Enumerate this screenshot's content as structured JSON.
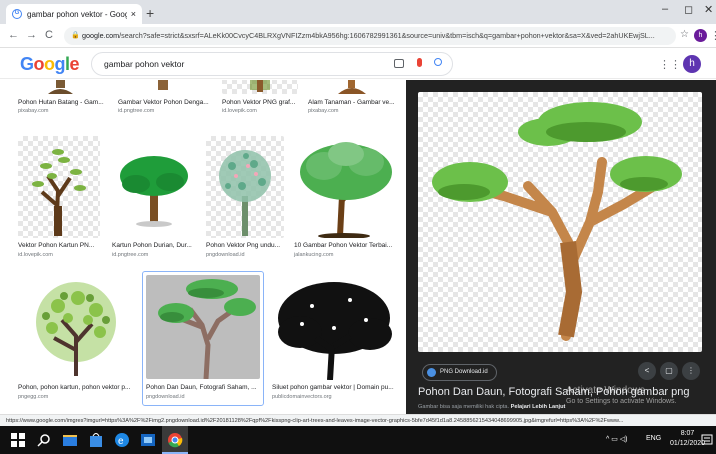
{
  "browser": {
    "tab_title": "gambar pohon vektor - Google I",
    "tab_favicon": "G",
    "tab_close": "×",
    "new_tab": "+",
    "win_min": "–",
    "win_max": "◻",
    "win_close": "✕",
    "back": "←",
    "forward": "→",
    "reload": "C",
    "url_host": "google.com",
    "url_rest": "/search?safe=strict&sxsrf=ALeKk00CvcyC4BLRXgVNFIZzm4bkA956hg:1606782991361&source=univ&tbm=isch&q=gambar+pohon+vektor&sa=X&ved=2ahUKEwjSL...",
    "star": "☆",
    "profile_letter": "h",
    "menu": "⋮"
  },
  "google": {
    "logo": [
      "G",
      "o",
      "o",
      "g",
      "l",
      "e"
    ],
    "query": "gambar pohon vektor",
    "apps_icon": "⋮⋮⋮",
    "avatar_letter": "h"
  },
  "results_row0": [
    {
      "title": "Pohon Hutan Batang - Gam...",
      "source": "pixabay.com"
    },
    {
      "title": "Gambar Vektor Pohon Denga...",
      "source": "id.pngtree.com"
    },
    {
      "title": "Pohon Vektor PNG graf...",
      "source": "id.lovepik.com"
    },
    {
      "title": "Alam Tanaman - Gambar ve...",
      "source": "pixabay.com"
    }
  ],
  "results_row1": [
    {
      "title": "Vektor Pohon Kartun PN...",
      "source": "id.lovepik.com"
    },
    {
      "title": "Kartun Pohon Durian, Dur...",
      "source": "id.pngtree.com"
    },
    {
      "title": "Pohon Vektor Png undu...",
      "source": "pngdownload.id"
    },
    {
      "title": "10 Gambar Pohon Vektor Terbai...",
      "source": "jalankucing.com"
    }
  ],
  "results_row2": [
    {
      "title": "Pohon, pohon kartun, pohon vektor p...",
      "source": "pngegg.com"
    },
    {
      "title": "Pohon Dan Daun, Fotografi Saham, ...",
      "source": "pngdownload.id"
    },
    {
      "title": "Siluet pohon gambar vektor | Domain pu...",
      "source": "publicdomainvectors.org"
    }
  ],
  "panel": {
    "close": "✕",
    "prev": "‹",
    "next": "›",
    "site_chip": "PNG Download.id",
    "share": "<",
    "save": "▢",
    "more": "⋮",
    "title": "Pohon Dan Daun, Fotografi Saham, Pohon gambar png",
    "subtitle": "Gambar bisa saja memiliki hak cipta.",
    "learn_more": "Pelajari Lebih Lanjut"
  },
  "watermark": {
    "line1": "Activate Windows",
    "line2": "Go to Settings to activate Windows."
  },
  "status_url": "https://www.google.com/imgres?imgurl=https%3A%2F%2Fimg2.pngdownload.id%2F20181128%2Fqpf%2Fkisspng-clip-art-trees-and-leaves-image-vector-graphics-5bfe7d45f1d1a8.2458856215434048699905.jpg&imgrefurl=https%3A%2F%2Fwww...",
  "taskbar": {
    "lang": "ENG",
    "tray_icons": "^ ▭ ◁)",
    "time": "8:07",
    "date": "01/12/2020"
  }
}
